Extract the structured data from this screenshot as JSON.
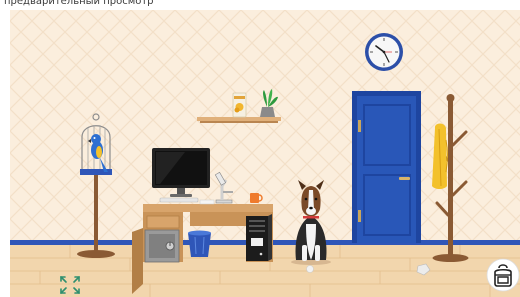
{
  "header": {
    "caption": "предварительный просмотр"
  },
  "scene": {
    "colors": {
      "wallpaper": "#fbeedd",
      "wallpaper_diamond": "#f3e0c8",
      "floor": "#f2d6ad",
      "floor_line": "#e3be8c",
      "baseboard": "#2f56b8",
      "door": "#2957b8",
      "desk": "#d8a46b",
      "coat_stand": "#8a5a34"
    },
    "clock": {
      "icon": "wall-clock-icon"
    },
    "buttons": {
      "fullscreen_icon": "expand-arrows-icon",
      "inventory_icon": "backpack-icon"
    }
  }
}
